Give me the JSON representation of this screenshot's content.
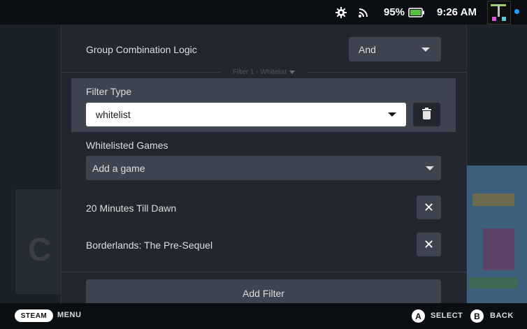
{
  "status_bar": {
    "battery_percent": "95%",
    "time": "9:26 AM",
    "icons": [
      "gear-icon",
      "wifi-icon",
      "battery-icon",
      "avatar"
    ]
  },
  "modal": {
    "group_logic": {
      "label": "Group Combination Logic",
      "value": "And"
    },
    "section_title": "Filter 1 - Whitelist",
    "filter_type": {
      "label": "Filter Type",
      "value": "whitelist"
    },
    "whitelisted": {
      "label": "Whitelisted Games",
      "add_placeholder": "Add a game",
      "games": [
        "20 Minutes Till Dawn",
        "Borderlands: The Pre-Sequel"
      ]
    },
    "add_filter_label": "Add Filter"
  },
  "bottom_bar": {
    "steam_label": "STEAM",
    "menu_label": "MENU",
    "a_button": "A",
    "select_label": "SELECT",
    "b_button": "B",
    "back_label": "BACK"
  },
  "colors": {
    "modal_bg": "#23262e",
    "control_bg": "#3d4450",
    "accent_blue": "#1a9fff",
    "battery_green": "#59bf40"
  }
}
